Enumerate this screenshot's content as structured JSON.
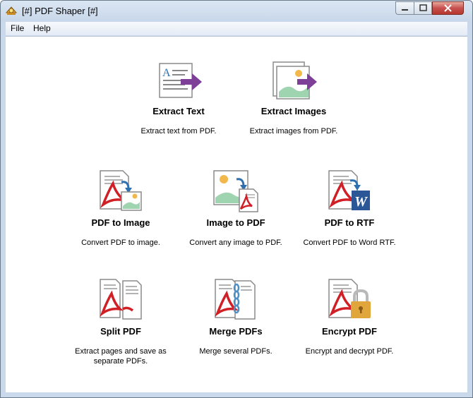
{
  "window": {
    "title": "[#] PDF Shaper [#]"
  },
  "menu": {
    "file": "File",
    "help": "Help"
  },
  "tools": {
    "extract_text": {
      "title": "Extract Text",
      "desc": "Extract text from PDF."
    },
    "extract_images": {
      "title": "Extract Images",
      "desc": "Extract images from PDF."
    },
    "pdf_to_image": {
      "title": "PDF to Image",
      "desc": "Convert PDF to image."
    },
    "image_to_pdf": {
      "title": "Image to PDF",
      "desc": "Convert any image to PDF."
    },
    "pdf_to_rtf": {
      "title": "PDF to RTF",
      "desc": "Convert PDF to Word RTF."
    },
    "split_pdf": {
      "title": "Split PDF",
      "desc": "Extract pages and save as separate PDFs."
    },
    "merge_pdfs": {
      "title": "Merge PDFs",
      "desc": "Merge several PDFs."
    },
    "encrypt_pdf": {
      "title": "Encrypt PDF",
      "desc": "Encrypt and decrypt PDF."
    }
  },
  "colors": {
    "pdf_red": "#d11f26",
    "arrow_purple": "#7d3f98",
    "arrow_blue": "#2f6fb0",
    "word_blue": "#2b5797",
    "lock_gold": "#e0a63c"
  }
}
